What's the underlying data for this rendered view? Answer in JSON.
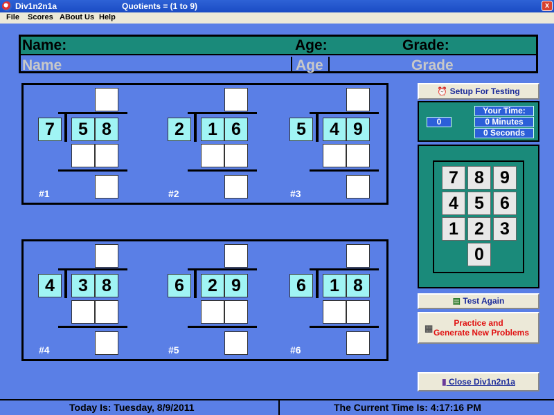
{
  "window": {
    "app_title": "Div1n2n1a",
    "doc_title": "Quotients = (1 to 9)",
    "close": "x"
  },
  "menu": [
    "File",
    "Scores",
    "ABout Us",
    "Help"
  ],
  "header": {
    "name_label": "Name:",
    "age_label": "Age:",
    "grade_label": "Grade:",
    "name_placeholder": "Name",
    "age_placeholder": "Age",
    "grade_placeholder": "Grade"
  },
  "problems": [
    {
      "label": "#1",
      "divisor": "7",
      "dividend": [
        "5",
        "8"
      ]
    },
    {
      "label": "#2",
      "divisor": "2",
      "dividend": [
        "1",
        "6"
      ]
    },
    {
      "label": "#3",
      "divisor": "5",
      "dividend": [
        "4",
        "9"
      ]
    },
    {
      "label": "#4",
      "divisor": "4",
      "dividend": [
        "3",
        "8"
      ]
    },
    {
      "label": "#5",
      "divisor": "6",
      "dividend": [
        "2",
        "9"
      ]
    },
    {
      "label": "#6",
      "divisor": "6",
      "dividend": [
        "1",
        "8"
      ]
    }
  ],
  "setup_button": "Setup  For Testing",
  "timer": {
    "count": "0",
    "your_time": "Your Time:",
    "minutes": "0 Minutes",
    "seconds": "0 Seconds"
  },
  "keypad": [
    "7",
    "8",
    "9",
    "4",
    "5",
    "6",
    "1",
    "2",
    "3",
    "0"
  ],
  "test_again_button": "Test Again",
  "practice_button": {
    "line1": "Practice and",
    "line2": "Generate New Problems",
    "color": "#e01010"
  },
  "close_button": "Close Div1n2n1a",
  "status": {
    "today": "Today Is:  Tuesday, 8/9/2011",
    "time": "The Current Time Is:    4:17:16 PM"
  },
  "colors": {
    "background": "#5a7fe6",
    "teal": "#1a8a7a",
    "digit_cell": "#a0f4f4"
  }
}
